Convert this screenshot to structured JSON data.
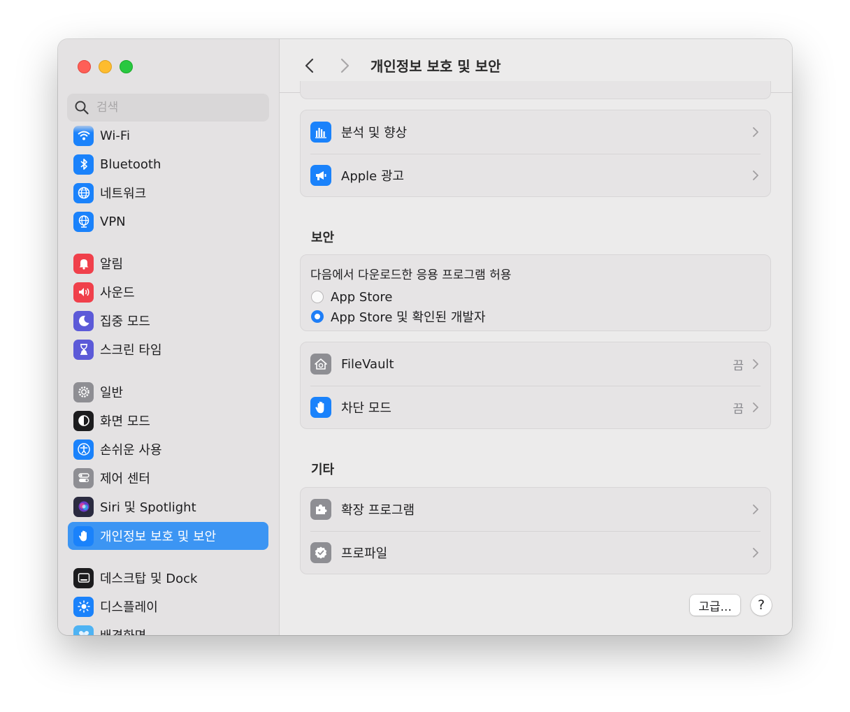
{
  "window": {
    "title": "개인정보 보호 및 보안"
  },
  "search": {
    "placeholder": "검색"
  },
  "sidebar": {
    "items": [
      {
        "label": "Wi-Fi",
        "icon": "wifi-icon",
        "color": "#1a82fb"
      },
      {
        "label": "Bluetooth",
        "icon": "bluetooth-icon",
        "color": "#1a82fb"
      },
      {
        "label": "네트워크",
        "icon": "globe-icon",
        "color": "#1a82fb"
      },
      {
        "label": "VPN",
        "icon": "vpn-globe-icon",
        "color": "#1a82fb"
      },
      {
        "label": "알림",
        "icon": "bell-icon",
        "color": "#f0404b"
      },
      {
        "label": "사운드",
        "icon": "speaker-icon",
        "color": "#f0404b"
      },
      {
        "label": "집중 모드",
        "icon": "moon-icon",
        "color": "#5c5ad8"
      },
      {
        "label": "스크린 타임",
        "icon": "hourglass-icon",
        "color": "#5c5ad8"
      },
      {
        "label": "일반",
        "icon": "gear-icon",
        "color": "#8e8e93"
      },
      {
        "label": "화면 모드",
        "icon": "appearance-icon",
        "color": "#1c1c1e"
      },
      {
        "label": "손쉬운 사용",
        "icon": "accessibility-icon",
        "color": "#1a82fb"
      },
      {
        "label": "제어 센터",
        "icon": "toggles-icon",
        "color": "#8e8e93"
      },
      {
        "label": "Siri 및 Spotlight",
        "icon": "siri-icon",
        "color": "#2b2b40"
      },
      {
        "label": "개인정보 보호 및 보안",
        "icon": "hand-icon",
        "color": "#1a82fb",
        "selected": true
      },
      {
        "label": "데스크탑 및 Dock",
        "icon": "dock-icon",
        "color": "#1c1c1e"
      },
      {
        "label": "디스플레이",
        "icon": "sun-icon",
        "color": "#1a82fb"
      },
      {
        "label": "배경화면",
        "icon": "wallpaper-icon",
        "color": "#4fb3f3"
      }
    ]
  },
  "privacy": {
    "rows": [
      {
        "label": "분석 및 향상",
        "icon": "chart-bars-icon",
        "color": "#1a82fb"
      },
      {
        "label": "Apple 광고",
        "icon": "megaphone-icon",
        "color": "#1a82fb"
      }
    ]
  },
  "security": {
    "title": "보안",
    "question": "다음에서 다운로드한 응용 프로그램 허용",
    "options": [
      {
        "label": "App Store",
        "selected": false
      },
      {
        "label": "App Store 및 확인된 개발자",
        "selected": true
      }
    ],
    "rows": [
      {
        "label": "FileVault",
        "value": "끔",
        "icon": "filevault-house-icon",
        "color": "#8e8e93"
      },
      {
        "label": "차단 모드",
        "value": "끔",
        "icon": "hand-icon",
        "color": "#1a82fb"
      }
    ]
  },
  "others": {
    "title": "기타",
    "rows": [
      {
        "label": "확장 프로그램",
        "icon": "puzzle-icon",
        "color": "#8e8e93"
      },
      {
        "label": "프로파일",
        "icon": "checkmark-seal-icon",
        "color": "#8e8e93"
      }
    ]
  },
  "footer": {
    "advanced_label": "고급...",
    "help_label": "?"
  }
}
